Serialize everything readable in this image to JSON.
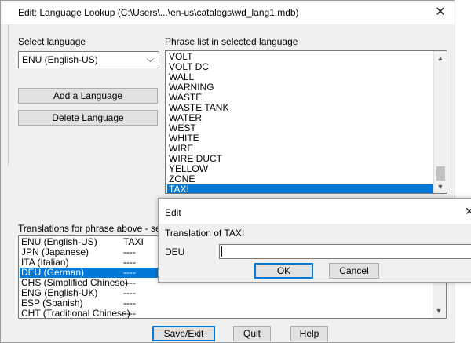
{
  "main": {
    "title": "Edit: Language Lookup (C:\\Users\\...\\en-us\\catalogs\\wd_lang1.mdb)",
    "close_glyph": "✕",
    "select_language_label": "Select language",
    "selected_language": "ENU (English-US)",
    "add_language_label": "Add a Language",
    "delete_language_label": "Delete Language",
    "phrase_list_label": "Phrase list in selected language",
    "phrases": [
      "VOLT",
      "VOLT DC",
      "WALL",
      "WARNING",
      "WASTE",
      "WASTE TANK",
      "WATER",
      "WEST",
      "WHITE",
      "WIRE",
      "WIRE DUCT",
      "YELLOW",
      "ZONE",
      "TAXI"
    ],
    "selected_phrase": "TAXI",
    "translations_label": "Translations for phrase above - select",
    "translations": [
      {
        "lang": "ENU (English-US)",
        "value": "TAXI"
      },
      {
        "lang": "JPN (Japanese)",
        "value": "----"
      },
      {
        "lang": "ITA (Italian)",
        "value": "----"
      },
      {
        "lang": "DEU (German)",
        "value": "----"
      },
      {
        "lang": "CHS (Simplified Chinese)",
        "value": "----"
      },
      {
        "lang": "ENG (English-UK)",
        "value": "----"
      },
      {
        "lang": "ESP (Spanish)",
        "value": "----"
      },
      {
        "lang": "CHT (Traditional Chinese)",
        "value": "----"
      }
    ],
    "selected_translation": "DEU (German)",
    "save_exit_label": "Save/Exit",
    "quit_label": "Quit",
    "help_label": "Help"
  },
  "edit_dialog": {
    "title": "Edit",
    "close_glyph": "✕",
    "translation_label": "Translation of TAXI",
    "field_label": "DEU",
    "field_value": "",
    "ok_label": "OK",
    "cancel_label": "Cancel"
  },
  "colors": {
    "selection": "#0078d7",
    "dialog_bg": "#f0f0f0",
    "button_bg": "#e1e1e1"
  }
}
